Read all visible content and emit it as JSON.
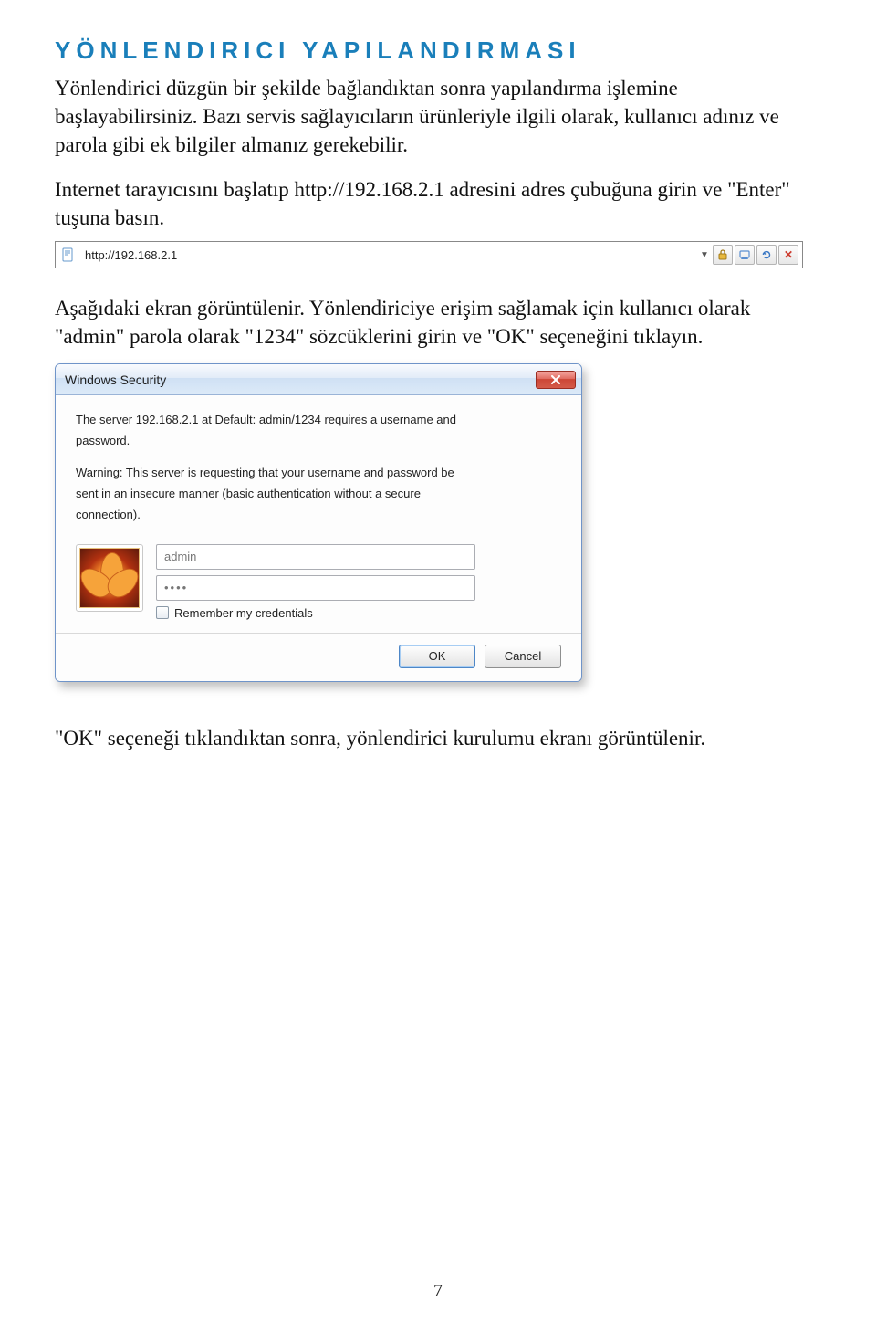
{
  "heading": "YÖNLENDIRICI YAPILANDIRMASI",
  "para1": "Yönlendirici düzgün bir şekilde bağlandıktan sonra yapılandırma işlemine başlayabilirsiniz. Bazı servis sağlayıcıların ürünleriyle ilgili olarak, kullanıcı adınız ve parola gibi ek bilgiler almanız gerekebilir.",
  "para2": "Internet tarayıcısını başlatıp http://192.168.2.1 adresini adres çubuğuna girin ve \"Enter\" tuşuna basın.",
  "address_bar": {
    "url": "http://192.168.2.1",
    "icons": {
      "page": "page-icon",
      "dropdown": "chevron-down-icon",
      "lock": "lock-icon",
      "compat": "compat-icon",
      "refresh": "refresh-icon",
      "stop": "stop-icon"
    }
  },
  "para3": "Aşağıdaki ekran görüntülenir. Yönlendiriciye erişim sağlamak için kullanıcı olarak \"admin\" parola olarak \"1234\" sözcüklerini girin ve \"OK\" seçeneğini tıklayın.",
  "dialog": {
    "title": "Windows Security",
    "line1": "The server 192.168.2.1 at Default: admin/1234 requires a username and",
    "line2": "password.",
    "warn1": "Warning: This server is requesting that your username and password be",
    "warn2": "sent in an insecure manner (basic authentication without a secure",
    "warn3": "connection).",
    "username": "admin",
    "password": "••••",
    "remember": "Remember my credentials",
    "ok": "OK",
    "cancel": "Cancel"
  },
  "para4": "\"OK\" seçeneği tıklandıktan sonra, yönlendirici kurulumu ekranı görüntülenir.",
  "page_number": "7"
}
